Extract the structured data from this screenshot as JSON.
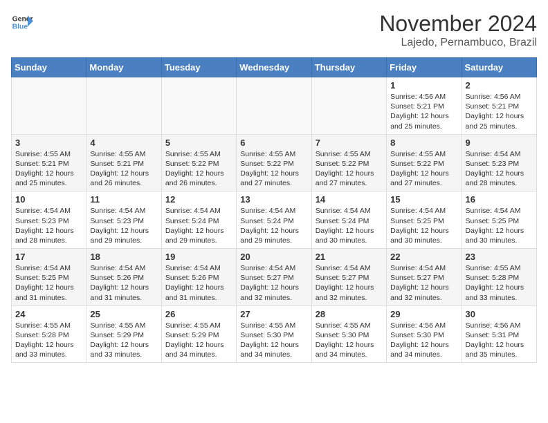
{
  "header": {
    "logo_line1": "General",
    "logo_line2": "Blue",
    "month_year": "November 2024",
    "location": "Lajedo, Pernambuco, Brazil"
  },
  "days_of_week": [
    "Sunday",
    "Monday",
    "Tuesday",
    "Wednesday",
    "Thursday",
    "Friday",
    "Saturday"
  ],
  "weeks": [
    [
      {
        "day": "",
        "info": ""
      },
      {
        "day": "",
        "info": ""
      },
      {
        "day": "",
        "info": ""
      },
      {
        "day": "",
        "info": ""
      },
      {
        "day": "",
        "info": ""
      },
      {
        "day": "1",
        "info": "Sunrise: 4:56 AM\nSunset: 5:21 PM\nDaylight: 12 hours and 25 minutes."
      },
      {
        "day": "2",
        "info": "Sunrise: 4:56 AM\nSunset: 5:21 PM\nDaylight: 12 hours and 25 minutes."
      }
    ],
    [
      {
        "day": "3",
        "info": "Sunrise: 4:55 AM\nSunset: 5:21 PM\nDaylight: 12 hours and 25 minutes."
      },
      {
        "day": "4",
        "info": "Sunrise: 4:55 AM\nSunset: 5:21 PM\nDaylight: 12 hours and 26 minutes."
      },
      {
        "day": "5",
        "info": "Sunrise: 4:55 AM\nSunset: 5:22 PM\nDaylight: 12 hours and 26 minutes."
      },
      {
        "day": "6",
        "info": "Sunrise: 4:55 AM\nSunset: 5:22 PM\nDaylight: 12 hours and 27 minutes."
      },
      {
        "day": "7",
        "info": "Sunrise: 4:55 AM\nSunset: 5:22 PM\nDaylight: 12 hours and 27 minutes."
      },
      {
        "day": "8",
        "info": "Sunrise: 4:55 AM\nSunset: 5:22 PM\nDaylight: 12 hours and 27 minutes."
      },
      {
        "day": "9",
        "info": "Sunrise: 4:54 AM\nSunset: 5:23 PM\nDaylight: 12 hours and 28 minutes."
      }
    ],
    [
      {
        "day": "10",
        "info": "Sunrise: 4:54 AM\nSunset: 5:23 PM\nDaylight: 12 hours and 28 minutes."
      },
      {
        "day": "11",
        "info": "Sunrise: 4:54 AM\nSunset: 5:23 PM\nDaylight: 12 hours and 29 minutes."
      },
      {
        "day": "12",
        "info": "Sunrise: 4:54 AM\nSunset: 5:24 PM\nDaylight: 12 hours and 29 minutes."
      },
      {
        "day": "13",
        "info": "Sunrise: 4:54 AM\nSunset: 5:24 PM\nDaylight: 12 hours and 29 minutes."
      },
      {
        "day": "14",
        "info": "Sunrise: 4:54 AM\nSunset: 5:24 PM\nDaylight: 12 hours and 30 minutes."
      },
      {
        "day": "15",
        "info": "Sunrise: 4:54 AM\nSunset: 5:25 PM\nDaylight: 12 hours and 30 minutes."
      },
      {
        "day": "16",
        "info": "Sunrise: 4:54 AM\nSunset: 5:25 PM\nDaylight: 12 hours and 30 minutes."
      }
    ],
    [
      {
        "day": "17",
        "info": "Sunrise: 4:54 AM\nSunset: 5:25 PM\nDaylight: 12 hours and 31 minutes."
      },
      {
        "day": "18",
        "info": "Sunrise: 4:54 AM\nSunset: 5:26 PM\nDaylight: 12 hours and 31 minutes."
      },
      {
        "day": "19",
        "info": "Sunrise: 4:54 AM\nSunset: 5:26 PM\nDaylight: 12 hours and 31 minutes."
      },
      {
        "day": "20",
        "info": "Sunrise: 4:54 AM\nSunset: 5:27 PM\nDaylight: 12 hours and 32 minutes."
      },
      {
        "day": "21",
        "info": "Sunrise: 4:54 AM\nSunset: 5:27 PM\nDaylight: 12 hours and 32 minutes."
      },
      {
        "day": "22",
        "info": "Sunrise: 4:54 AM\nSunset: 5:27 PM\nDaylight: 12 hours and 32 minutes."
      },
      {
        "day": "23",
        "info": "Sunrise: 4:55 AM\nSunset: 5:28 PM\nDaylight: 12 hours and 33 minutes."
      }
    ],
    [
      {
        "day": "24",
        "info": "Sunrise: 4:55 AM\nSunset: 5:28 PM\nDaylight: 12 hours and 33 minutes."
      },
      {
        "day": "25",
        "info": "Sunrise: 4:55 AM\nSunset: 5:29 PM\nDaylight: 12 hours and 33 minutes."
      },
      {
        "day": "26",
        "info": "Sunrise: 4:55 AM\nSunset: 5:29 PM\nDaylight: 12 hours and 34 minutes."
      },
      {
        "day": "27",
        "info": "Sunrise: 4:55 AM\nSunset: 5:30 PM\nDaylight: 12 hours and 34 minutes."
      },
      {
        "day": "28",
        "info": "Sunrise: 4:55 AM\nSunset: 5:30 PM\nDaylight: 12 hours and 34 minutes."
      },
      {
        "day": "29",
        "info": "Sunrise: 4:56 AM\nSunset: 5:30 PM\nDaylight: 12 hours and 34 minutes."
      },
      {
        "day": "30",
        "info": "Sunrise: 4:56 AM\nSunset: 5:31 PM\nDaylight: 12 hours and 35 minutes."
      }
    ]
  ]
}
